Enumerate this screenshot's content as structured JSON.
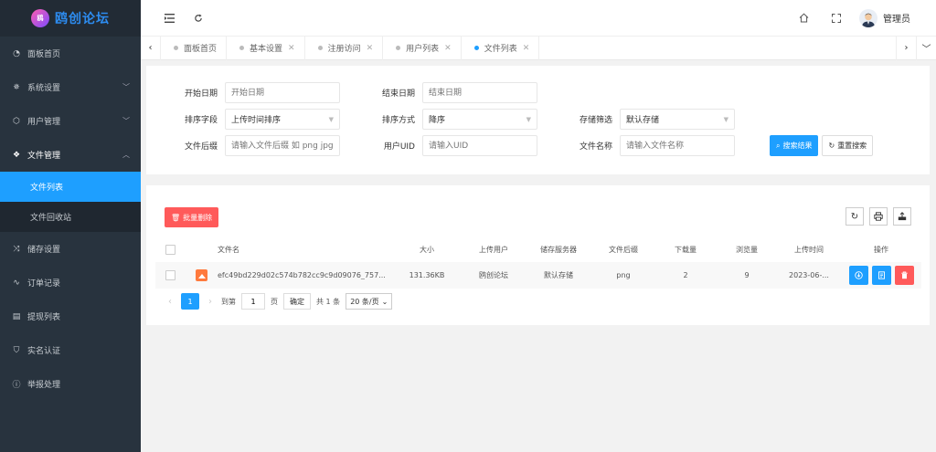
{
  "app": {
    "logo_mark": "鸥",
    "title": "鸥创论坛"
  },
  "sidebar": {
    "items": [
      {
        "label": "面板首页",
        "icon": "dashboard-icon"
      },
      {
        "label": "系统设置",
        "icon": "gear-icon"
      },
      {
        "label": "用户管理",
        "icon": "box-icon"
      },
      {
        "label": "文件管理",
        "icon": "layers-icon"
      },
      {
        "label": "储存设置",
        "icon": "shuffle-icon"
      },
      {
        "label": "订单记录",
        "icon": "pulse-icon"
      },
      {
        "label": "提现列表",
        "icon": "clipboard-icon"
      },
      {
        "label": "实名认证",
        "icon": "shield-check-icon"
      },
      {
        "label": "举报处理",
        "icon": "info-circle-icon"
      }
    ],
    "file_submenu": [
      {
        "label": "文件列表",
        "active": true
      },
      {
        "label": "文件回收站",
        "active": false
      }
    ]
  },
  "header": {
    "user_name": "管理员"
  },
  "tabs": [
    {
      "label": "面板首页",
      "active": false,
      "closable": false
    },
    {
      "label": "基本设置",
      "active": false,
      "closable": true
    },
    {
      "label": "注册访问",
      "active": false,
      "closable": true
    },
    {
      "label": "用户列表",
      "active": false,
      "closable": true
    },
    {
      "label": "文件列表",
      "active": true,
      "closable": true
    }
  ],
  "search": {
    "start_date_label": "开始日期",
    "start_date_placeholder": "开始日期",
    "end_date_label": "结束日期",
    "end_date_placeholder": "结束日期",
    "sort_field_label": "排序字段",
    "sort_field_value": "上传时间排序",
    "sort_order_label": "排序方式",
    "sort_order_value": "降序",
    "storage_label": "存储筛选",
    "storage_value": "默认存储",
    "ext_label": "文件后缀",
    "ext_placeholder": "请输入文件后缀 如 png jpg 等",
    "uid_label": "用户UID",
    "uid_placeholder": "请输入UID",
    "name_label": "文件名称",
    "name_placeholder": "请输入文件名称",
    "search_button": "搜索结果",
    "reset_button": "重置搜索"
  },
  "table": {
    "batch_delete": "批量删除",
    "columns": [
      "文件名",
      "大小",
      "上传用户",
      "储存服务器",
      "文件后缀",
      "下载量",
      "浏览量",
      "上传时间",
      "操作"
    ],
    "rows": [
      {
        "name": "efc49bd229d02c574b782cc9c9d09076_757...",
        "size": "131.36KB",
        "user": "鸥创论坛",
        "server": "默认存储",
        "ext": "png",
        "downloads": "2",
        "views": "9",
        "time": "2023-06-..."
      }
    ]
  },
  "pager": {
    "current_page": "1",
    "goto_label": "到第",
    "goto_value": "1",
    "page_unit": "页",
    "confirm": "确定",
    "total": "共 1 条",
    "page_size": "20 条/页"
  },
  "colors": {
    "accent": "#1e9fff",
    "danger": "#ff5a5a",
    "sidebar_bg": "#28333e"
  }
}
